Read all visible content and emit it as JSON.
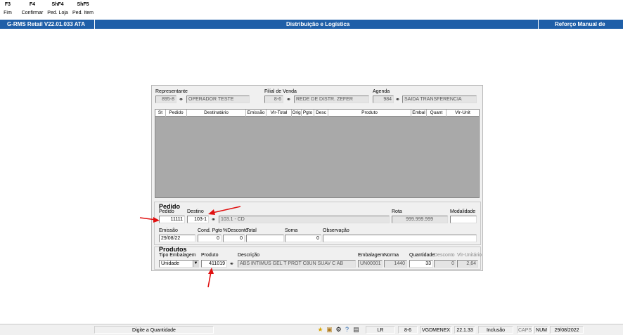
{
  "toolbar": {
    "items": [
      {
        "key": "F3",
        "label": "Fim"
      },
      {
        "key": "F4",
        "label": "Confirmar"
      },
      {
        "key": "ShF4",
        "label": "Ped. Loja"
      },
      {
        "key": "ShF5",
        "label": "Ped. Item"
      }
    ]
  },
  "titlebar": {
    "app": "G-RMS Retail V22.01.033 ATA",
    "module": "Distribuição e Logística",
    "screen": "Reforço Manual de Pedido"
  },
  "header": {
    "representante_label": "Representante",
    "representante_code": "895-8",
    "representante_name": "OPERADOR TESTE",
    "filial_label": "Filial de Venda",
    "filial_code": "8-6",
    "filial_name": "REDE DE DISTR. ZEFER",
    "agenda_label": "Agenda",
    "agenda_code": "984",
    "agenda_name": "SAIDA TRANSFERENCIA"
  },
  "grid": {
    "columns": [
      "St",
      "Pedido",
      "Destinatário",
      "Emissão",
      "Vlr-Total",
      "Orig",
      "Pgto",
      "Desc",
      "Produto",
      "Embal",
      "Quant",
      "Vlr-Unit"
    ]
  },
  "pedido": {
    "title": "Pedido",
    "pedido_label": "Pedido",
    "pedido_value": "11111",
    "destino_label": "Destino",
    "destino_value": "103-1",
    "destino_name": "103.1 - CD",
    "rota_label": "Rota",
    "rota_value": "999.999.999",
    "modalidade_label": "Modalidade",
    "modalidade_value": "",
    "emissao_label": "Emissão",
    "emissao_value": "29/08/22",
    "cond_label": "Cond. Pgto",
    "cond_value": "0",
    "desconto_label": "%Desconto",
    "desconto_value": "0",
    "total_label": "Total",
    "total_value": "",
    "soma_label": "Soma",
    "soma_value": "0",
    "obs_label": "Observação",
    "obs_value": ""
  },
  "produtos": {
    "title": "Produtos",
    "tipo_label": "Tipo Embalagem",
    "tipo_value": "Unidade",
    "produto_label": "Produto",
    "produto_value": "411019",
    "descricao_label": "Descrição",
    "descricao_value": "ABS INTIMUS GEL T PROT C8UN SUAV C AB",
    "embalagem_label": "Embalagem",
    "embalagem_value": "UN00001",
    "norma_label": "Norma",
    "norma_value": "1440",
    "quantidade_label": "Quantidade",
    "quantidade_value": "33",
    "desconto_label": "Desconto",
    "desconto_value": "0",
    "vlrunit_label": "Vlr-Unitário",
    "vlrunit_value": "2,64"
  },
  "statusbar": {
    "message": "Digite a Quantidade",
    "mode": "LR",
    "filial": "8-6",
    "user": "VGDMENEX",
    "version": "22.1.33",
    "action": "Inclusão",
    "caps": "CAPS",
    "num": "NUM",
    "date": "29/08/2022"
  },
  "icons": [
    "star-icon",
    "folder-icon",
    "help-icon",
    "clipboard-icon",
    "binoculars-icon"
  ],
  "colors": {
    "titlebar": "#1f5fa8",
    "grid_body": "#a9a9a9",
    "annotation_arrow": "#e01010"
  }
}
